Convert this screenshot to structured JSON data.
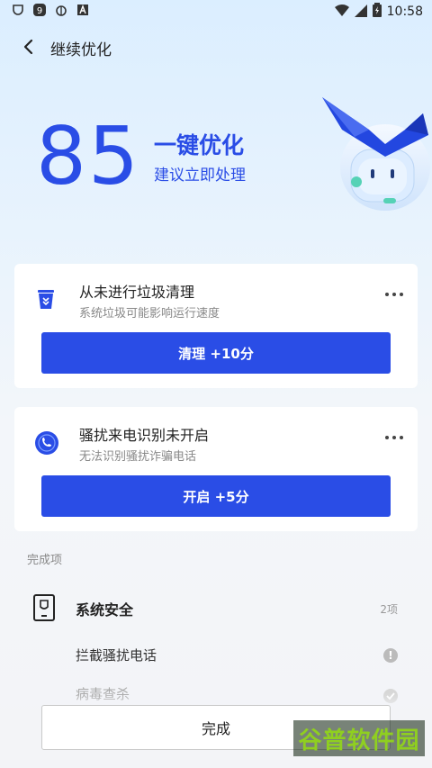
{
  "status_bar": {
    "left_icons": [
      "security-icon",
      "app-9-icon",
      "bug-icon",
      "translate-icon"
    ],
    "time": "10:58"
  },
  "header": {
    "title": "继续优化",
    "back_icon": "chevron-left-icon"
  },
  "hero": {
    "score": "85",
    "title": "一键优化",
    "subtitle": "建议立即处理"
  },
  "cards": [
    {
      "title": "从未进行垃圾清理",
      "desc": "系统垃圾可能影响运行速度",
      "button": "清理 +10分",
      "icon": "trash-icon"
    },
    {
      "title": "骚扰来电识别未开启",
      "desc": "无法识别骚扰诈骗电话",
      "button": "开启 +5分",
      "icon": "phone-icon"
    }
  ],
  "completed": {
    "section_label": "完成项",
    "system_security": {
      "title": "系统安全",
      "count": "2项",
      "items": [
        {
          "label": "拦截骚扰电话",
          "status_icon": "info-icon",
          "status_text": "!"
        },
        {
          "label": "病毒查杀",
          "status_icon": "check-icon"
        }
      ]
    }
  },
  "footer": {
    "done_button": "完成"
  },
  "watermark": {
    "text": "谷普软件园"
  },
  "colors": {
    "accent": "#2a4de6",
    "background_top": "#dbeeff",
    "background_bottom": "#f3f4f7"
  }
}
